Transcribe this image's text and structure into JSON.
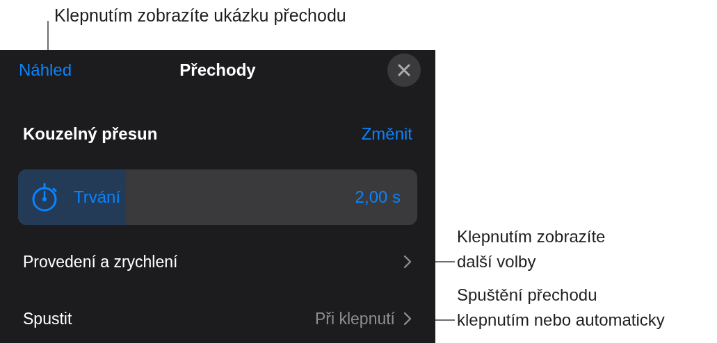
{
  "callouts": [
    {
      "text": "Klepnutím zobrazíte ukázku přechodu"
    },
    {
      "text": "Klepnutím zobrazíte\ndalší volby"
    },
    {
      "text": "Spuštění přechodu\nklepnutím nebo automaticky"
    }
  ],
  "panel": {
    "preview_button": "Náhled",
    "title": "Přechody",
    "effect": {
      "name": "Kouzelný přesun",
      "change_button": "Změnit"
    },
    "duration": {
      "label": "Trvání",
      "value": "2,00 s",
      "level": 0.27
    },
    "rows": [
      {
        "label": "Provedení a zrychlení"
      },
      {
        "label": "Spustit",
        "value": "Při klepnutí"
      }
    ]
  }
}
